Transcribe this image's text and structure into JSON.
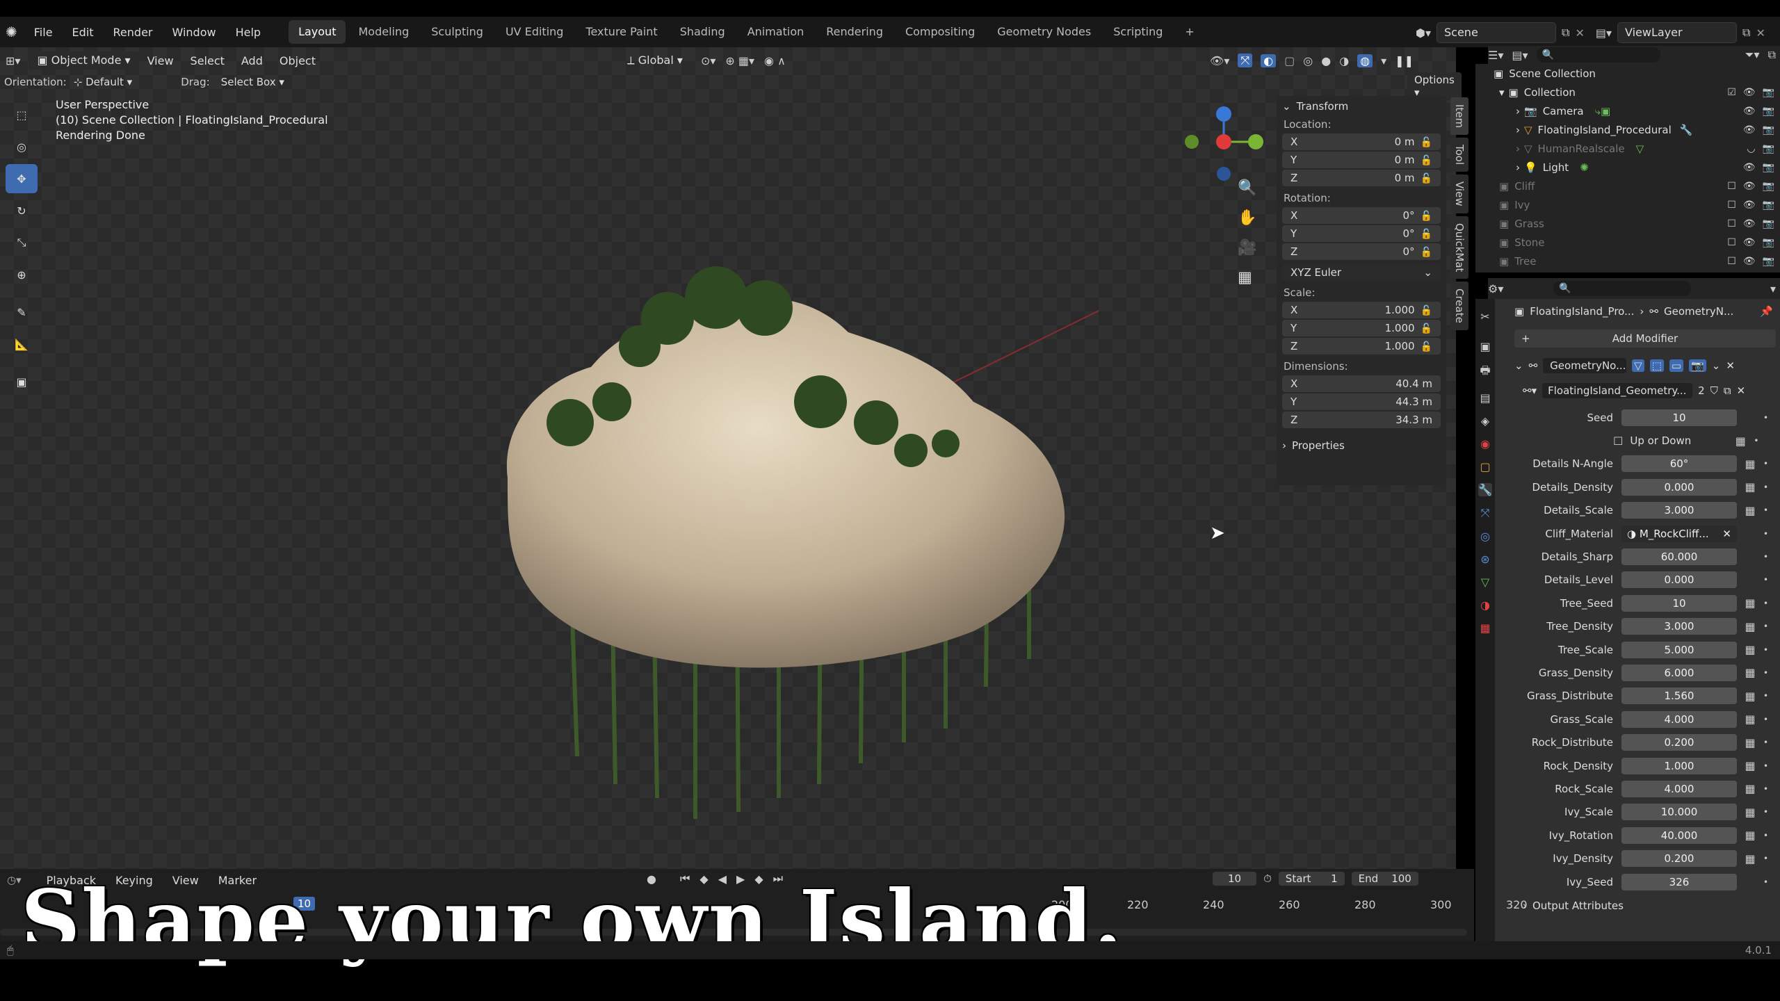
{
  "menu": [
    "File",
    "Edit",
    "Render",
    "Window",
    "Help"
  ],
  "workspaces": [
    {
      "label": "Layout",
      "active": true
    },
    {
      "label": "Modeling"
    },
    {
      "label": "Sculpting"
    },
    {
      "label": "UV Editing"
    },
    {
      "label": "Texture Paint"
    },
    {
      "label": "Shading"
    },
    {
      "label": "Animation"
    },
    {
      "label": "Rendering"
    },
    {
      "label": "Compositing"
    },
    {
      "label": "Geometry Nodes"
    },
    {
      "label": "Scripting"
    }
  ],
  "scene": {
    "name": "Scene",
    "view_layer": "ViewLayer"
  },
  "viewport_header": {
    "mode": "Object Mode",
    "menus": [
      "View",
      "Select",
      "Add",
      "Object"
    ],
    "transform_space": "Global",
    "options": "Options",
    "orientation_label": "Orientation:",
    "orientation_value": "Default",
    "drag_label": "Drag:",
    "drag_value": "Select Box"
  },
  "viewport_info": {
    "line1": "User Perspective",
    "line2": "(10) Scene Collection | FloatingIsland_Procedural",
    "line3": "Rendering Done"
  },
  "npanel": {
    "title": "Transform",
    "location_label": "Location:",
    "location": [
      {
        "axis": "X",
        "value": "0 m"
      },
      {
        "axis": "Y",
        "value": "0 m"
      },
      {
        "axis": "Z",
        "value": "0 m"
      }
    ],
    "rotation_label": "Rotation:",
    "rotation": [
      {
        "axis": "X",
        "value": "0°"
      },
      {
        "axis": "Y",
        "value": "0°"
      },
      {
        "axis": "Z",
        "value": "0°"
      }
    ],
    "rotation_mode": "XYZ Euler",
    "scale_label": "Scale:",
    "scale": [
      {
        "axis": "X",
        "value": "1.000"
      },
      {
        "axis": "Y",
        "value": "1.000"
      },
      {
        "axis": "Z",
        "value": "1.000"
      }
    ],
    "dimensions_label": "Dimensions:",
    "dimensions": [
      {
        "axis": "X",
        "value": "40.4 m"
      },
      {
        "axis": "Y",
        "value": "44.3 m"
      },
      {
        "axis": "Z",
        "value": "34.3 m"
      }
    ],
    "properties_label": "Properties"
  },
  "side_tabs": [
    "Item",
    "Tool",
    "View",
    "QuickMat",
    "Create"
  ],
  "outliner": {
    "root": "Scene Collection",
    "collection": "Collection",
    "items": [
      {
        "name": "Camera",
        "dim": false
      },
      {
        "name": "FloatingIsland_Procedural",
        "dim": false
      },
      {
        "name": "HumanRealscale",
        "dim": true
      },
      {
        "name": "Light",
        "dim": false
      }
    ],
    "other_collections": [
      "Cliff",
      "Ivy",
      "Grass",
      "Stone",
      "Tree"
    ]
  },
  "properties": {
    "breadcrumb_object": "FloatingIsland_Pro...",
    "breadcrumb_modifier": "GeometryN...",
    "add_modifier": "Add Modifier",
    "modifier_name": "GeometryNo...",
    "node_group": "FloatingIsland_Geometry...",
    "node_group_users": "2",
    "params": [
      {
        "label": "Seed",
        "value": "10",
        "toggle": false
      },
      {
        "label": "Up or Down",
        "checkbox": true
      },
      {
        "label": "Details N-Angle",
        "value": "60°",
        "toggle": true
      },
      {
        "label": "Details_Density",
        "value": "0.000",
        "toggle": true
      },
      {
        "label": "Details_Scale",
        "value": "3.000",
        "toggle": true
      },
      {
        "label": "Cliff_Material",
        "value": "M_RockCliff...",
        "material": true
      },
      {
        "label": "Details_Sharp",
        "value": "60.000",
        "toggle": false
      },
      {
        "label": "Details_Level",
        "value": "0.000",
        "toggle": false
      },
      {
        "label": "Tree_Seed",
        "value": "10",
        "toggle": true
      },
      {
        "label": "Tree_Density",
        "value": "3.000",
        "toggle": true
      },
      {
        "label": "Tree_Scale",
        "value": "5.000",
        "toggle": true
      },
      {
        "label": "Grass_Density",
        "value": "6.000",
        "toggle": true
      },
      {
        "label": "Grass_Distribute",
        "value": "1.560",
        "toggle": true
      },
      {
        "label": "Grass_Scale",
        "value": "4.000",
        "toggle": true
      },
      {
        "label": "Rock_Distribute",
        "value": "0.200",
        "toggle": true
      },
      {
        "label": "Rock_Density",
        "value": "1.000",
        "toggle": true
      },
      {
        "label": "Rock_Scale",
        "value": "4.000",
        "toggle": true
      },
      {
        "label": "Ivy_Scale",
        "value": "10.000",
        "toggle": true
      },
      {
        "label": "Ivy_Rotation",
        "value": "40.000",
        "toggle": true
      },
      {
        "label": "Ivy_Density",
        "value": "0.200",
        "toggle": true
      },
      {
        "label": "Ivy_Seed",
        "value": "326",
        "toggle": false
      }
    ],
    "output_attributes": "Output Attributes"
  },
  "timeline": {
    "menus": [
      "Playback",
      "Keying",
      "View",
      "Marker"
    ],
    "current_frame": "10",
    "start_label": "Start",
    "start": "1",
    "end_label": "End",
    "end": "100",
    "ticks_visible": [
      "200",
      "220",
      "240",
      "260",
      "280",
      "300",
      "320"
    ],
    "playhead_label": "10"
  },
  "caption": "Shape your own Island.",
  "version": "4.0.1",
  "colors": {
    "accent_blue": "#3f6cb0",
    "axis_x": "#e03a3a",
    "axis_y": "#7ab534",
    "axis_z": "#3a78d6"
  }
}
